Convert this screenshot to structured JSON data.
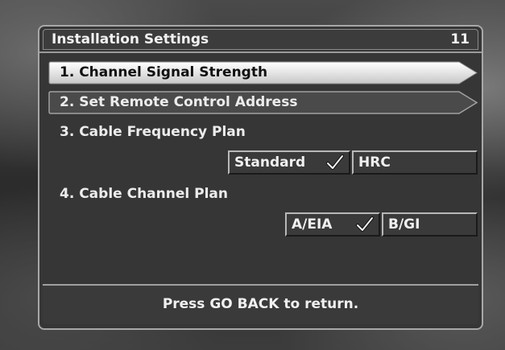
{
  "dialog": {
    "title": "Installation Settings",
    "page_number": "11"
  },
  "menu": {
    "items": [
      {
        "label": "1.  Channel Signal Strength",
        "state": "highlighted"
      },
      {
        "label": "2.  Set Remote Control Address",
        "state": "normal"
      },
      {
        "label": "3.  Cable Frequency Plan",
        "state": "normal"
      },
      {
        "label": "4.  Cable Channel Plan",
        "state": "normal"
      }
    ]
  },
  "frequency_plan": {
    "options": [
      {
        "label": "Standard",
        "selected": true
      },
      {
        "label": "HRC",
        "selected": false
      }
    ]
  },
  "channel_plan": {
    "options": [
      {
        "label": "A/EIA",
        "selected": true
      },
      {
        "label": "B/GI",
        "selected": false
      }
    ]
  },
  "footer": {
    "hint": "Press GO BACK to return."
  },
  "icons": {
    "selected_marker": "check-icon"
  },
  "colors": {
    "highlight": "#f4f4f4",
    "panel": "#363636",
    "border": "#a8a8a8",
    "text": "#f0f0f0"
  }
}
